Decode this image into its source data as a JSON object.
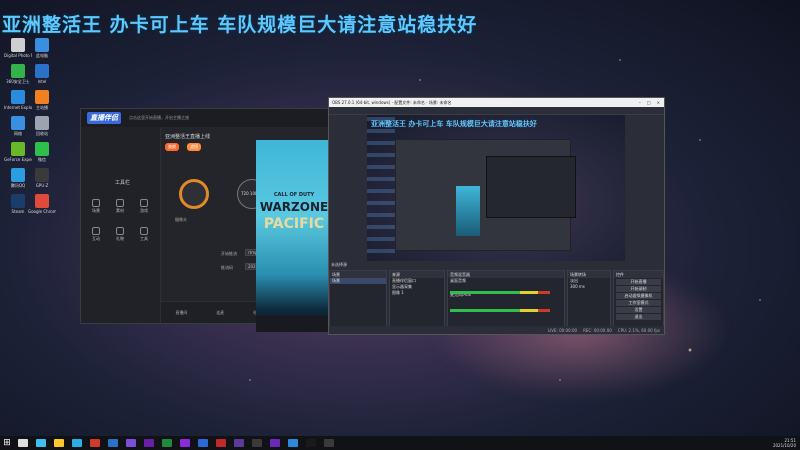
{
  "overlay": {
    "banner": "亚洲整活王 办卡可上车 车队规模巨大请注意站稳扶好"
  },
  "desktop_icons": [
    {
      "label": "Digital Photo Prof...",
      "color": "#cfcfcf"
    },
    {
      "label": "此电脑",
      "color": "#3a8fe0"
    },
    {
      "label": "360安全卫士",
      "color": "#34b34a"
    },
    {
      "label": "Intel",
      "color": "#2a72c8"
    },
    {
      "label": "Internet Explorer",
      "color": "#2a8cde"
    },
    {
      "label": "主站播",
      "color": "#f08020"
    },
    {
      "label": "网络",
      "color": "#3a90e0"
    },
    {
      "label": "回收站",
      "color": "#9aa5b0"
    },
    {
      "label": "GeForce Experience",
      "color": "#6ab82a"
    },
    {
      "label": "微信",
      "color": "#2ec04a"
    },
    {
      "label": "腾讯QQ",
      "color": "#2a9ee0"
    },
    {
      "label": "GPU-Z",
      "color": "#3a3a3a"
    },
    {
      "label": "Steam",
      "color": "#1b3d6a"
    },
    {
      "label": "Google Chrome",
      "color": "#e04a3a"
    }
  ],
  "stream_app": {
    "logo": "直播伴侣",
    "tip": "点击这里开始直播，开启主播之旅",
    "title": "亚洲整活王直播上线",
    "chip1": "美颜",
    "chip2": "滤镜",
    "sidebar": [
      "场景",
      "素材",
      "游戏",
      "互动",
      "礼物",
      "工具"
    ],
    "section": "工具栏",
    "labels": {
      "camera": "摄像头",
      "res": "720 1080",
      "start": "开始直播"
    },
    "fields": {
      "field1_label": "开始推流",
      "field1_value": "rtmp://1234",
      "field2_label": "推流码",
      "field2_value": "20210320"
    },
    "bottom": [
      "直播间",
      "连麦",
      "礼物",
      "设置",
      "更多"
    ]
  },
  "poster": {
    "cod": "CALL OF DUTY",
    "wz": "WARZONE",
    "pc": "PACIFIC"
  },
  "obs": {
    "title": "OBS 27.0.1 (64-bit, windows) - 配置文件: 未命名 - 场景: 未命名",
    "preview_banner": "亚洲整活王 办卡可上车 车队规模巨大请注意站稳扶好",
    "strip_label": "未选择源",
    "docks": {
      "scenes": {
        "title": "场景",
        "items": [
          "场景"
        ]
      },
      "sources": {
        "title": "来源",
        "items": [
          "直播伴侣窗口",
          "显示器采集",
          "图像 1"
        ]
      },
      "mixer": {
        "title": "音频混音器",
        "tracks": [
          "桌面音频",
          "麦克风/Aux"
        ]
      },
      "transitions": {
        "title": "场景转场",
        "type": "淡出",
        "duration": "300 ms"
      },
      "controls": {
        "title": "控件",
        "buttons": [
          "开始直播",
          "开始录制",
          "启动虚拟摄像机",
          "工作室模式",
          "设置",
          "退出"
        ]
      }
    },
    "status": [
      "LIVE: 00:00:00",
      "REC: 00:00:00",
      "CPU: 2.1%, 60.00 fps"
    ]
  },
  "taskbar": {
    "start_icon": "windows-logo-icon",
    "apps": [
      "#e0e0e0",
      "#3ec0f0",
      "#ffc82a",
      "#2ab0e8",
      "#cf3a2a",
      "#2a72c8",
      "#7b4fd8",
      "#6a1fa8",
      "#1f8a3a",
      "#8a2ad8",
      "#2a6ad8",
      "#c02a2a",
      "#5a3a9a",
      "#3a3a3a",
      "#6a2ab8",
      "#2a8adc",
      "#1a1a1a",
      "#3a3a3a"
    ],
    "time": "21:51",
    "date": "2021/10/20"
  }
}
